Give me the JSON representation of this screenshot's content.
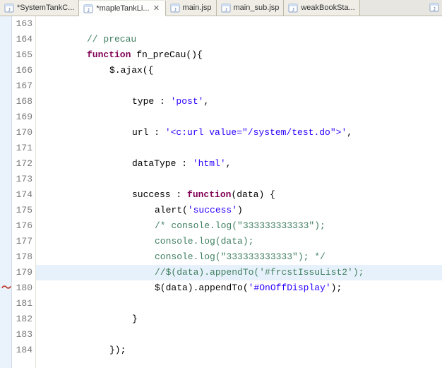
{
  "tabs": [
    {
      "label": "*SystemTankC...",
      "active": false
    },
    {
      "label": "*mapleTankLi...",
      "active": true
    },
    {
      "label": "main.jsp",
      "active": false
    },
    {
      "label": "main_sub.jsp",
      "active": false
    },
    {
      "label": "weakBookSta...",
      "active": false
    }
  ],
  "lines": {
    "start": 163,
    "rows": [
      {
        "n": 163,
        "segs": []
      },
      {
        "n": 164,
        "segs": [
          {
            "t": "// precau",
            "c": "cm"
          }
        ],
        "ind": 2
      },
      {
        "n": 165,
        "segs": [
          {
            "t": "function",
            "c": "kw"
          },
          {
            "t": " fn_preCau(){",
            "c": "plain"
          }
        ],
        "ind": 2
      },
      {
        "n": 166,
        "segs": [
          {
            "t": "$.ajax({",
            "c": "plain"
          }
        ],
        "ind": 3
      },
      {
        "n": 167,
        "segs": [],
        "ind": 3
      },
      {
        "n": 168,
        "segs": [
          {
            "t": "type : ",
            "c": "plain"
          },
          {
            "t": "'post'",
            "c": "str"
          },
          {
            "t": ",",
            "c": "plain"
          }
        ],
        "ind": 4
      },
      {
        "n": 169,
        "segs": [],
        "ind": 4
      },
      {
        "n": 170,
        "segs": [
          {
            "t": "url : ",
            "c": "plain"
          },
          {
            "t": "'<c:url value=\"/system/test.do\">'",
            "c": "str"
          },
          {
            "t": ",",
            "c": "plain"
          }
        ],
        "ind": 4
      },
      {
        "n": 171,
        "segs": [],
        "ind": 4
      },
      {
        "n": 172,
        "segs": [
          {
            "t": "dataType : ",
            "c": "plain"
          },
          {
            "t": "'html'",
            "c": "str"
          },
          {
            "t": ",",
            "c": "plain"
          }
        ],
        "ind": 4
      },
      {
        "n": 173,
        "segs": [],
        "ind": 4
      },
      {
        "n": 174,
        "segs": [
          {
            "t": "success : ",
            "c": "plain"
          },
          {
            "t": "function",
            "c": "kw"
          },
          {
            "t": "(data) {",
            "c": "plain"
          }
        ],
        "ind": 4
      },
      {
        "n": 175,
        "segs": [
          {
            "t": "alert(",
            "c": "plain"
          },
          {
            "t": "'success'",
            "c": "str"
          },
          {
            "t": ")",
            "c": "plain"
          }
        ],
        "ind": 5
      },
      {
        "n": 176,
        "segs": [
          {
            "t": "/* console.log(\"333333333333\");",
            "c": "cmml"
          }
        ],
        "ind": 5
      },
      {
        "n": 177,
        "segs": [
          {
            "t": "console.log(data);",
            "c": "cmml"
          }
        ],
        "ind": 5
      },
      {
        "n": 178,
        "segs": [
          {
            "t": "console.log(\"333333333333\"); */",
            "c": "cmml"
          }
        ],
        "ind": 5
      },
      {
        "n": 179,
        "segs": [
          {
            "t": "//$(data).appendTo('#frcstIssuList2');",
            "c": "cm"
          }
        ],
        "ind": 5,
        "hl": true
      },
      {
        "n": 180,
        "segs": [
          {
            "t": "$(data).appendTo(",
            "c": "plain"
          },
          {
            "t": "'#OnOffDisplay'",
            "c": "str"
          },
          {
            "t": ");",
            "c": "plain"
          }
        ],
        "ind": 5,
        "mark": true
      },
      {
        "n": 181,
        "segs": [],
        "ind": 5
      },
      {
        "n": 182,
        "segs": [
          {
            "t": "}",
            "c": "plain"
          }
        ],
        "ind": 4
      },
      {
        "n": 183,
        "segs": [],
        "ind": 3
      },
      {
        "n": 184,
        "segs": [
          {
            "t": "});",
            "c": "plain"
          }
        ],
        "ind": 3
      }
    ]
  },
  "close_glyph": "✕"
}
